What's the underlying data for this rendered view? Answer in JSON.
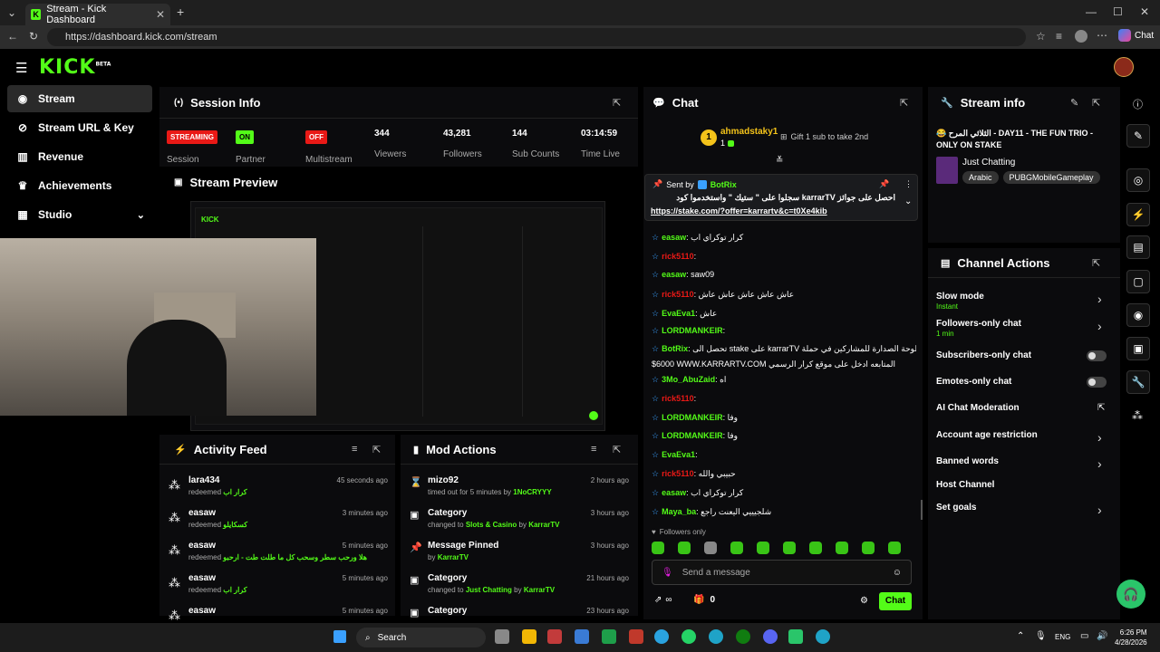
{
  "browser": {
    "tab_title": "Stream - Kick Dashboard",
    "url": "https://dashboard.kick.com/stream",
    "copilot_label": "Chat"
  },
  "app": {
    "logo": "KICK",
    "logo_sup": "BETA"
  },
  "sidebar": {
    "items": [
      {
        "label": "Stream",
        "icon": "broadcast-icon"
      },
      {
        "label": "Stream URL & Key",
        "icon": "link-icon"
      },
      {
        "label": "Revenue",
        "icon": "chart-icon"
      },
      {
        "label": "Achievements",
        "icon": "trophy-icon"
      },
      {
        "label": "Studio",
        "icon": "grid-icon"
      }
    ]
  },
  "session": {
    "title": "Session Info",
    "stats": [
      {
        "badge": "STREAMING",
        "label": "Session"
      },
      {
        "badge": "ON",
        "label": "Partner"
      },
      {
        "badge": "OFF",
        "label": "Multistream"
      },
      {
        "value": "344",
        "label": "Viewers"
      },
      {
        "value": "43,281",
        "label": "Followers"
      },
      {
        "value": "144",
        "label": "Sub Counts"
      },
      {
        "value": "03:14:59",
        "label": "Time Live"
      }
    ]
  },
  "preview": {
    "title": "Stream Preview"
  },
  "activity": {
    "title": "Activity Feed",
    "items": [
      {
        "name": "lara434",
        "action": "redeemed",
        "reward": "كرار اب",
        "time": "45 seconds ago"
      },
      {
        "name": "easaw",
        "action": "redeemed",
        "reward": "كسكايلو",
        "time": "3 minutes ago"
      },
      {
        "name": "easaw",
        "action": "redeemed",
        "reward": "هلا ورحب سطر وسحب كل ما طلت طت - ارحبو",
        "time": "5 minutes ago"
      },
      {
        "name": "easaw",
        "action": "redeemed",
        "reward": "كرار اب",
        "time": "5 minutes ago"
      },
      {
        "name": "easaw",
        "action": "",
        "reward": "",
        "time": "5 minutes ago"
      }
    ]
  },
  "mod": {
    "title": "Mod Actions",
    "items": [
      {
        "title": "mizo92",
        "pre": "timed out for 5 minutes by",
        "target": "",
        "by": "1NoCRYYY",
        "time": "2 hours ago",
        "icon": "hourglass-icon"
      },
      {
        "title": "Category",
        "pre": "changed to",
        "target": "Slots & Casino",
        "by": "KarrarTV",
        "time": "3 hours ago",
        "icon": "category-icon"
      },
      {
        "title": "Message Pinned",
        "pre": "by",
        "target": "",
        "by": "KarrarTV",
        "time": "3 hours ago",
        "icon": "pin-icon"
      },
      {
        "title": "Category",
        "pre": "changed to",
        "target": "Just Chatting",
        "by": "KarrarTV",
        "time": "21 hours ago",
        "icon": "category-icon"
      },
      {
        "title": "Category",
        "pre": "",
        "target": "",
        "by": "",
        "time": "23 hours ago",
        "icon": "category-icon"
      }
    ]
  },
  "chat": {
    "title": "Chat",
    "top_gifter": {
      "name": "ahmadstaky1",
      "count": "1",
      "cta": "Gift 1 sub to take 2nd"
    },
    "pinned": {
      "sent_by_label": "Sent by",
      "sender": "BotRix",
      "text": "احصل على جوائز karrarTV سجلوا على \" ستيك \" واستخدموا كود",
      "link": "https://stake.com/?offer=karrartv&c=t0Xe4kib"
    },
    "messages": [
      {
        "user": "easaw",
        "color": "#53fc18",
        "text": "كرار توكراي اب"
      },
      {
        "user": "rick5110",
        "color": "#e91916",
        "text": ""
      },
      {
        "user": "easaw",
        "color": "#53fc18",
        "text": "saw09"
      },
      {
        "user": "rick5110",
        "color": "#e91916",
        "text": "عاش عاش عاش عاش عاش"
      },
      {
        "user": "EvaEva1",
        "color": "#53fc18",
        "text": "عاش"
      },
      {
        "user": "LORDMANKEIR",
        "color": "#53fc18",
        "text": ""
      },
      {
        "user": "BotRix",
        "color": "#53fc18",
        "text": "تحصل الى stake على karrarTV جوائز لوحة الصدارة للمشاركين في حملة"
      },
      {
        "user": "",
        "color": "#fff",
        "text": "$6000 WWW.KARRARTV.COM المتابعه ادخل على موقع كرار الرسمي"
      },
      {
        "user": "3Mo_AbuZaid",
        "color": "#53fc18",
        "text": "اه"
      },
      {
        "user": "rick5110",
        "color": "#e91916",
        "text": ""
      },
      {
        "user": "LORDMANKEIR",
        "color": "#53fc18",
        "text": "وفا"
      },
      {
        "user": "LORDMANKEIR",
        "color": "#53fc18",
        "text": "وفا"
      },
      {
        "user": "EvaEva1",
        "color": "#53fc18",
        "text": ""
      },
      {
        "user": "rick5110",
        "color": "#e91916",
        "text": "حبيبي والله"
      },
      {
        "user": "easaw",
        "color": "#53fc18",
        "text": "كرار توكراي اب"
      },
      {
        "user": "Maya_ba",
        "color": "#53fc18",
        "text": "شلجيييي اليعنت راجع"
      }
    ],
    "mode": "Followers only",
    "input_placeholder": "Send a message",
    "viewer_count": "0",
    "send_label": "Chat"
  },
  "stream_info": {
    "title": "Stream info",
    "stream_title": "😂 الثلاثي المرح - DAY11 - THE FUN TRIO - ONLY ON STAKE",
    "category": "Just Chatting",
    "tags": [
      "Arabic",
      "PUBGMobileGameplay"
    ]
  },
  "channel_actions": {
    "title": "Channel Actions",
    "items": [
      {
        "label": "Slow mode",
        "sub": "Instant",
        "control": "chevron"
      },
      {
        "label": "Followers-only chat",
        "sub": "1 min",
        "control": "chevron"
      },
      {
        "label": "Subscribers-only chat",
        "sub": "",
        "control": "toggle"
      },
      {
        "label": "Emotes-only chat",
        "sub": "",
        "control": "toggle"
      },
      {
        "label": "AI Chat Moderation",
        "sub": "",
        "control": "external"
      },
      {
        "label": "Account age restriction",
        "sub": "",
        "control": "chevron"
      },
      {
        "label": "Banned words",
        "sub": "",
        "control": "chevron"
      },
      {
        "label": "Host Channel",
        "sub": "",
        "control": "none"
      },
      {
        "label": "Set goals",
        "sub": "",
        "control": "chevron"
      }
    ]
  },
  "taskbar": {
    "search": "Search",
    "lang": "ENG",
    "time": "6:26 PM",
    "date": "4/28/2026"
  },
  "colors": {
    "accent": "#53fc18",
    "danger": "#e91916",
    "panel": "#0b0b0d"
  }
}
